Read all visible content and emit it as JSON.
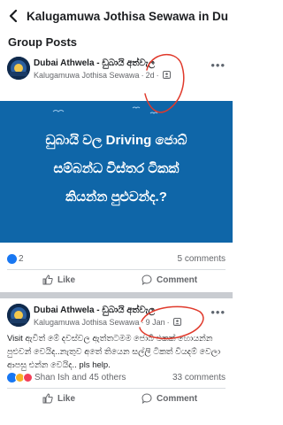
{
  "header": {
    "title": "Kalugamuwa Jothisa Sewawa in Dubai..."
  },
  "section": {
    "title": "Group Posts"
  },
  "posts": [
    {
      "author": "Dubai Athwela - ඩුබායි අත්වැල",
      "group": "Kalugamuwa Jothisa Sewawa",
      "time": "2d",
      "image_lines": [
        "ඩුබායි වල Driving ජොබ්",
        "සම්බන්ධ විස්තර ටිකක්",
        "කියන්න පුළුවන්ද.?"
      ],
      "reactions_count": "2",
      "comments": "5 comments",
      "like_label": "Like",
      "comment_label": "Comment"
    },
    {
      "author": "Dubai Athwela - ඩුබායි අත්වැල",
      "group": "Kalugamuwa Jothisa Sewawa",
      "time": "9 Jan",
      "text": "Visit ඇවිත් මේ දවස්වල ඇත්තටමම ජොබ් එකක් හොයන්න පුළුවන් වෙයිද..නැතුව අතේ තියෙන සල්ලි ටිකත් වියදම් වෙලා ආපසු එන්න වෙයිද.. pls help.",
      "reactions_text": "Shan Ish and 45 others",
      "comments": "33 comments",
      "like_label": "Like",
      "comment_label": "Comment"
    }
  ],
  "colors": {
    "accent": "#1877f2",
    "image_bg": "#0f66a8",
    "scribble": "#e0392b"
  }
}
